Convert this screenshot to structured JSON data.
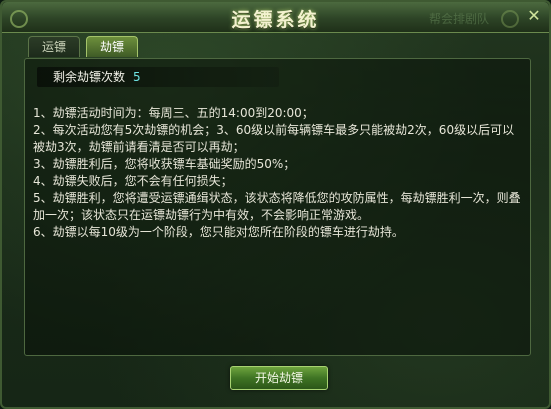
{
  "window": {
    "title": "运镖系统",
    "title_right_text": "帮会排剧队"
  },
  "tabs": [
    {
      "label": "运镖",
      "active": false
    },
    {
      "label": "劫镖",
      "active": true
    }
  ],
  "remaining": {
    "label": "剩余劫镖次数",
    "value": "5"
  },
  "rules": [
    "1、劫镖活动时间为：每周三、五的14:00到20:00；",
    "2、每次活动您有5次劫镖的机会；3、60级以前每辆镖车最多只能被劫2次，60级以后可以被劫3次，劫镖前请看清是否可以再劫；",
    "3、劫镖胜利后，您将收获镖车基础奖励的50%；",
    "4、劫镖失败后，您不会有任何损失；",
    "5、劫镖胜利，您将遭受运镖通缉状态，该状态将降低您的攻防属性，每劫镖胜利一次，则叠加一次；该状态只在运镖劫镖行为中有效，不会影响正常游戏。",
    "6、劫镖以每10级为一个阶段，您只能对您所在阶段的镖车进行劫持。"
  ],
  "start_button": {
    "label": "开始劫镖"
  },
  "icons": {
    "close": "close-icon"
  },
  "colors": {
    "accent_green": "#6ea43d",
    "value_cyan": "#6fe3e3",
    "title_text": "#f3f2cf"
  }
}
